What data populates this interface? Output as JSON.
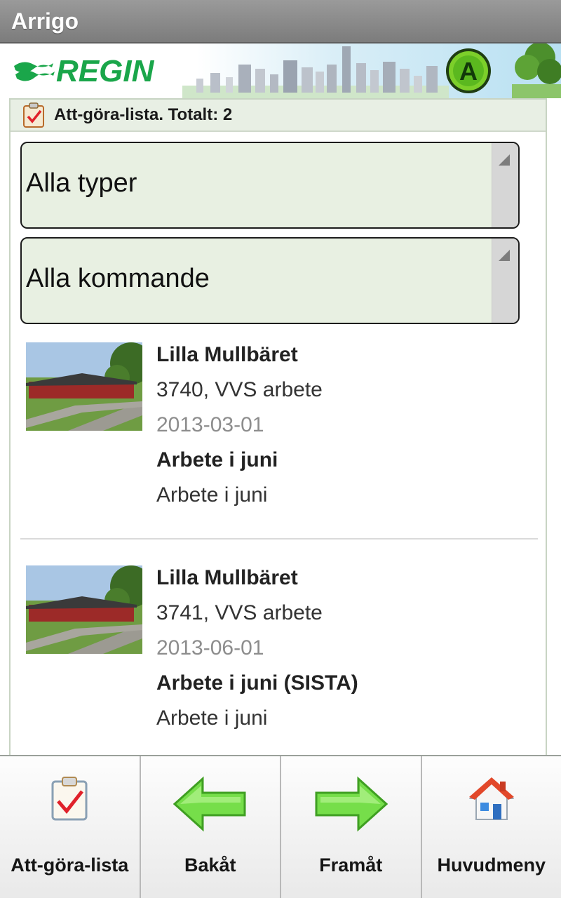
{
  "app": {
    "title": "Arrigo"
  },
  "banner": {
    "logo_text": "REGIN",
    "badge_letter": "A"
  },
  "header": {
    "title": "Att-göra-lista. Totalt: 2"
  },
  "filters": {
    "type_selected": "Alla typer",
    "time_selected": "Alla kommande"
  },
  "items": [
    {
      "name": "Lilla Mullbäret",
      "work": "3740, VVS arbete",
      "date": "2013-03-01",
      "heading": "Arbete i juni",
      "description": "Arbete i juni"
    },
    {
      "name": "Lilla Mullbäret",
      "work": "3741, VVS arbete",
      "date": "2013-06-01",
      "heading": "Arbete i juni (SISTA)",
      "description": "Arbete i juni"
    }
  ],
  "toolbar": {
    "todo_label": "Att-göra-lista",
    "back_label": "Bakåt",
    "forward_label": "Framåt",
    "home_label": "Huvudmeny"
  },
  "colors": {
    "brand_green": "#1aa64a",
    "select_bg": "#e8f0e2",
    "arrow_green": "#6fd94a"
  },
  "icons": {
    "header": "clipboard-check-icon",
    "todo": "clipboard-check-icon",
    "back": "arrow-left-icon",
    "forward": "arrow-right-icon",
    "home": "house-icon"
  }
}
